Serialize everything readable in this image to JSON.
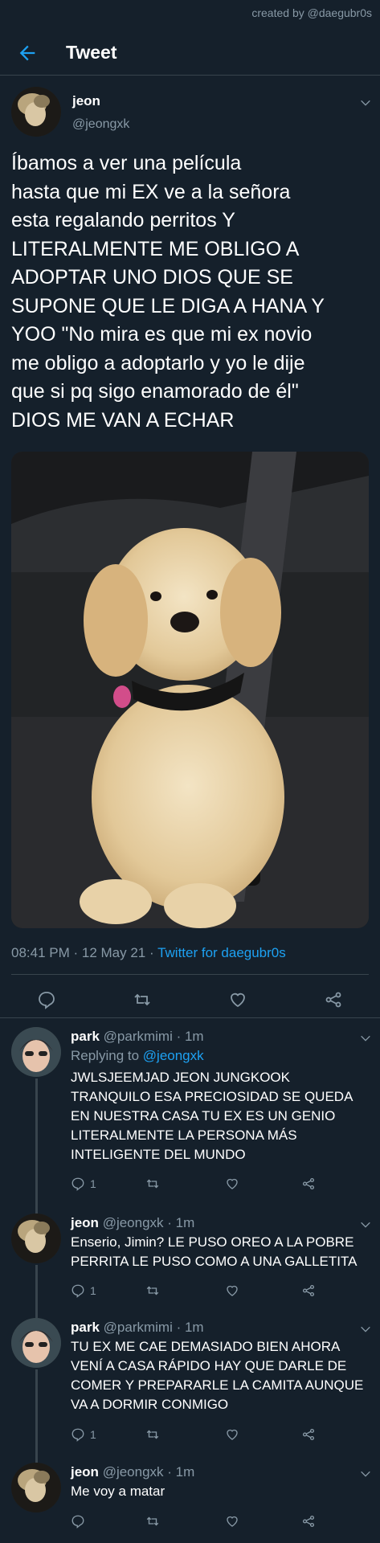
{
  "watermark": "created by @daegubr0s",
  "header": {
    "title": "Tweet",
    "back_icon": "arrow-left-icon"
  },
  "main_tweet": {
    "name": "jeon",
    "handle": "@jeongxk",
    "text": "Íbamos a ver una película\nhasta que mi EX ve a la señora\nesta regalando perritos Y\nLITERALMENTE ME OBLIGO A\nADOPTAR UNO DIOS QUE SE\nSUPONE QUE LE DIGA A HANA Y\nYOO \"No mira es que mi ex novio\nme obligo a adoptarlo y yo le dije\nque si pq sigo enamorado de él\"\nDIOS ME VAN A ECHAR",
    "time": "08:41 PM · 12 May 21 · ",
    "source": "Twitter for daegubr0s",
    "photo_subject": "golden retriever puppy in car seat"
  },
  "replies": [
    {
      "name": "park",
      "handle": "@parkmimi · 1m",
      "replying_label": "Replying to ",
      "replying_to": "@jeongxk",
      "text": "JWLSJEEMJAD JEON JUNGKOOK TRANQUILO ESA PRECIOSIDAD SE QUEDA EN NUESTRA CASA TU EX ES UN GENIO LITERALMENTE LA PERSONA MÁS INTELIGENTE DEL MUNDO",
      "reply_count": "1"
    },
    {
      "name": "jeon",
      "handle": "@jeongxk · 1m",
      "text": "Enserio, Jimin? LE PUSO OREO A LA POBRE PERRITA LE PUSO COMO A UNA GALLETITA",
      "reply_count": "1"
    },
    {
      "name": "park",
      "handle": "@parkmimi · 1m",
      "text": "TU EX ME CAE DEMASIADO BIEN AHORA VENÍ A CASA RÁPIDO HAY QUE DARLE DE COMER Y PREPARARLE LA CAMITA AUNQUE VA A DORMIR CONMIGO",
      "reply_count": "1"
    },
    {
      "name": "jeon",
      "handle": "@jeongxk · 1m",
      "text": "Me voy a matar",
      "reply_count": ""
    }
  ],
  "colors": {
    "background": "#15202b",
    "accent": "#1da1f2",
    "muted": "#8899a6",
    "border": "#38444d"
  }
}
